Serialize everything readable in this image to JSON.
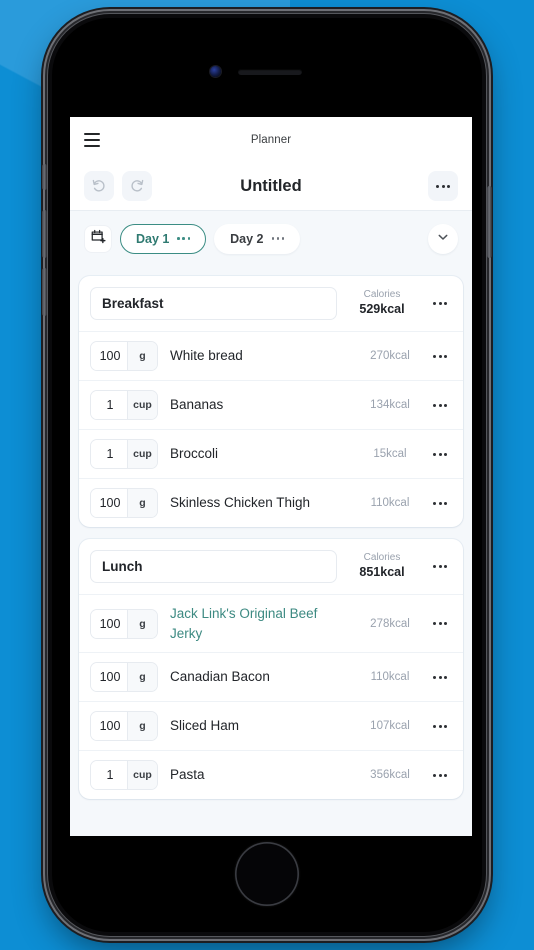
{
  "theme": {
    "background_blue": "#0d8ed4",
    "accent_teal": "#3d8a82",
    "panel_bg": "#f5f8fb",
    "text_dark": "#22252a",
    "text_muted": "#9aa2ae"
  },
  "phone": {
    "camera_icon": "camera-icon",
    "speaker_icon": "speaker-grille-icon",
    "home_button_icon": "home-button-icon"
  },
  "topbar": {
    "menu_icon": "hamburger-menu-icon",
    "app_title": "Planner",
    "undo_icon": "undo-icon",
    "redo_icon": "redo-icon",
    "document_title": "Untitled",
    "more_icon": "more-options-icon"
  },
  "daysbar": {
    "add_day_icon": "calendar-add-icon",
    "collapse_icon": "chevron-down-icon",
    "days": [
      {
        "label": "Day 1",
        "active": true,
        "more_icon": "more-options-icon"
      },
      {
        "label": "Day 2",
        "active": false,
        "more_icon": "more-options-icon"
      }
    ]
  },
  "meals": [
    {
      "name": "Breakfast",
      "name_placeholder": "Meal name",
      "calories_label": "Calories",
      "calories_value": "529kcal",
      "more_icon": "more-options-icon",
      "items": [
        {
          "qty": "100",
          "unit": "g",
          "name": "White bread",
          "calories": "270kcal",
          "linked": false,
          "more_icon": "more-options-icon"
        },
        {
          "qty": "1",
          "unit": "cup",
          "name": "Bananas",
          "calories": "134kcal",
          "linked": false,
          "more_icon": "more-options-icon"
        },
        {
          "qty": "1",
          "unit": "cup",
          "name": "Broccoli",
          "calories": "15kcal",
          "linked": false,
          "more_icon": "more-options-icon"
        },
        {
          "qty": "100",
          "unit": "g",
          "name": "Skinless Chicken Thigh",
          "calories": "110kcal",
          "linked": false,
          "more_icon": "more-options-icon"
        }
      ]
    },
    {
      "name": "Lunch",
      "name_placeholder": "Meal name",
      "calories_label": "Calories",
      "calories_value": "851kcal",
      "more_icon": "more-options-icon",
      "items": [
        {
          "qty": "100",
          "unit": "g",
          "name": "Jack Link's Original Beef Jerky",
          "calories": "278kcal",
          "linked": true,
          "more_icon": "more-options-icon"
        },
        {
          "qty": "100",
          "unit": "g",
          "name": "Canadian Bacon",
          "calories": "110kcal",
          "linked": false,
          "more_icon": "more-options-icon"
        },
        {
          "qty": "100",
          "unit": "g",
          "name": "Sliced Ham",
          "calories": "107kcal",
          "linked": false,
          "more_icon": "more-options-icon"
        },
        {
          "qty": "1",
          "unit": "cup",
          "name": "Pasta",
          "calories": "356kcal",
          "linked": false,
          "more_icon": "more-options-icon"
        }
      ]
    }
  ]
}
